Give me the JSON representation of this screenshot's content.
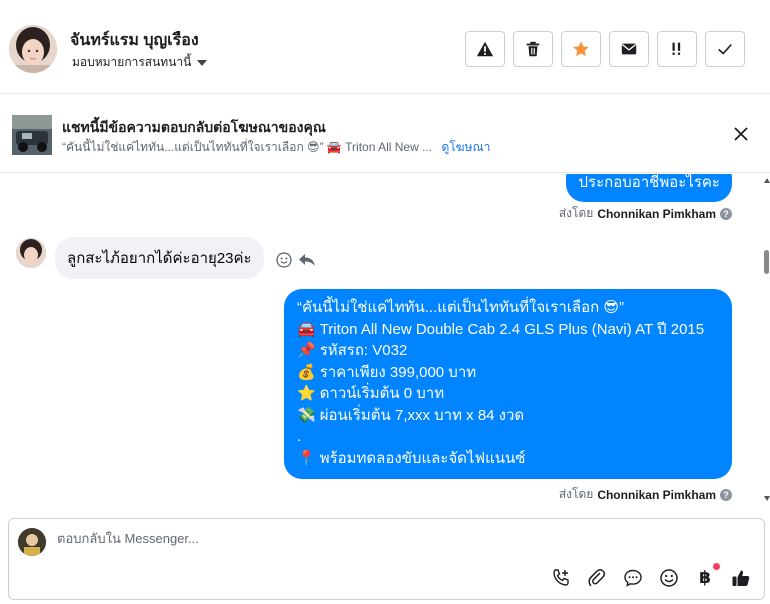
{
  "header": {
    "contact_name": "จันทร์แรม บุญเรือง",
    "assign_label": "มอบหมายการสนทนานี้",
    "actions": [
      {
        "name": "warning-button",
        "icon": "warning-icon"
      },
      {
        "name": "delete-button",
        "icon": "trash-icon"
      },
      {
        "name": "star-button",
        "icon": "star-icon",
        "color": "#f7923b"
      },
      {
        "name": "mark-unread-button",
        "icon": "envelope-icon"
      },
      {
        "name": "follow-up-button",
        "icon": "exclamation-icon"
      },
      {
        "name": "done-button",
        "icon": "check-icon"
      }
    ]
  },
  "ad_banner": {
    "title": "แชทนี้มีข้อความตอบกลับต่อโฆษณาของคุณ",
    "snippet": "“คันนี้ไม่ใช่แค่ไททัน...แต่เป็นไททันที่ใจเราเลือก 😎” 🚘 Triton All New ...",
    "link": "ดูโฆษณา"
  },
  "messages": {
    "outgoing_1": "ประกอบอาชีพอะไรคะ",
    "sent_by_prefix": "ส่งโดย",
    "sent_by_name": "Chonnikan Pimkham",
    "incoming_1": "ลูกสะไภ้อยากได้ค่ะอายุ23ค่ะ",
    "outgoing_2_lines": [
      {
        "emoji": "",
        "text": "“คันนี้ไม่ใช่แค่ไททัน...แต่เป็นไททันที่ใจเราเลือก 😎”"
      },
      {
        "emoji": "🚘",
        "text": "Triton All New Double Cab 2.4 GLS Plus (Navi) AT ปี 2015"
      },
      {
        "emoji": "📌",
        "text": "รหัสรถ: V032"
      },
      {
        "emoji": "💰",
        "text": "ราคาเพียง 399,000 บาท"
      },
      {
        "emoji": "⭐",
        "text": "ดาวน์เริ่มต้น 0 บาท"
      },
      {
        "emoji": "💸",
        "text": "ผ่อนเริ่มต้น 7,xxx บาท x 84 งวด"
      },
      {
        "emoji": "",
        "text": "."
      },
      {
        "emoji": "📍",
        "text": "พร้อมทดลองขับและจัดไฟแนนซ์"
      }
    ]
  },
  "composer": {
    "placeholder": "ตอบกลับใน Messenger...",
    "baht_symbol": "฿"
  },
  "colors": {
    "accent": "#0084ff",
    "link": "#1877f2",
    "star": "#f7923b"
  }
}
